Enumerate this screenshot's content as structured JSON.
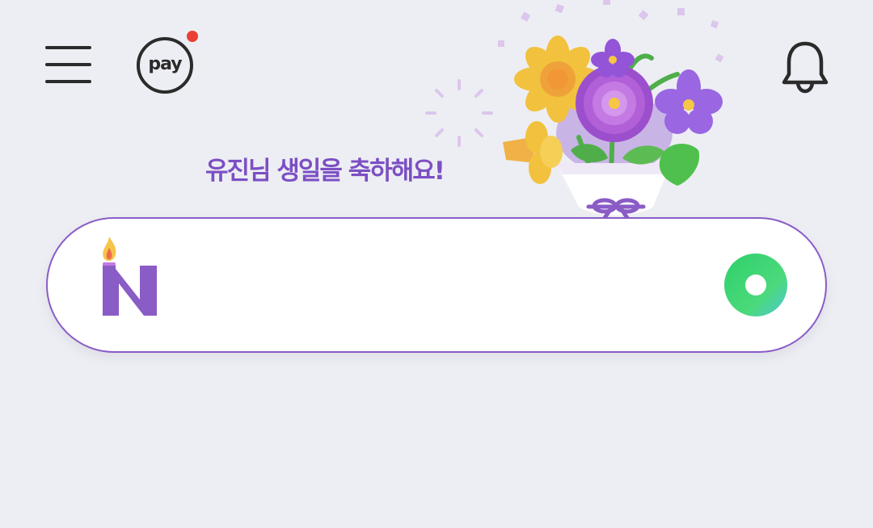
{
  "header": {
    "menu_icon": "hamburger-menu-icon",
    "pay_label": "pay",
    "pay_badge_color": "#ea3f33",
    "notification_icon": "bell-icon"
  },
  "banner": {
    "greeting": "유진님 생일을 축하해요!",
    "illustration": "flower-bouquet-illustration",
    "greeting_color": "#7c4fc4"
  },
  "search": {
    "value": "",
    "placeholder": "",
    "logo_icon": "naver-birthday-candle-logo-icon",
    "action_icon": "green-circle-search-icon",
    "border_color": "#8a5cc6",
    "accent_color": "#2fd06b"
  }
}
